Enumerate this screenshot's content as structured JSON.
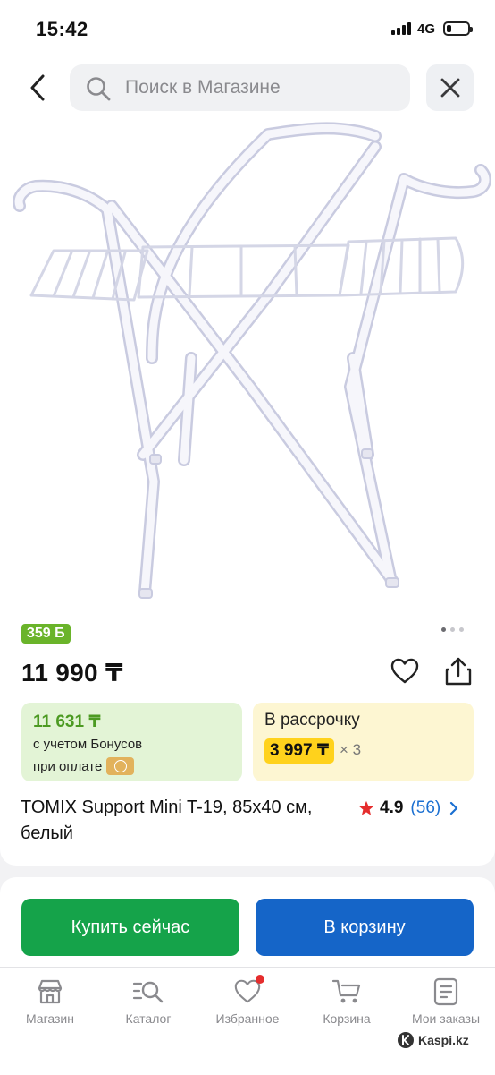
{
  "status_bar": {
    "time": "15:42",
    "network": "4G",
    "battery_level": 0.15
  },
  "header": {
    "search_placeholder": "Поиск в Магазине",
    "back_icon": "chevron-left-icon",
    "close_icon": "close-icon"
  },
  "product": {
    "image_alt": "folding bath stand",
    "image_index": 1,
    "image_count": 3,
    "bonus_badge": "359 Б",
    "price": "11 990 ₸",
    "bonus_price": "11 631 ₸",
    "bonus_line1": "с учетом Бонусов",
    "bonus_line2": "при оплате",
    "installment_label": "В рассрочку",
    "installment_price": "3 997 ₸",
    "installment_multiplier": "× 3",
    "title": "TOMIX Support Mini T-19, 85x40 см, белый",
    "rating": "4.9",
    "reviews": "(56)"
  },
  "actions": {
    "buy_now": "Купить сейчас",
    "add_to_cart": "В корзину"
  },
  "tabs": [
    {
      "label": "Магазин",
      "icon": "store-icon"
    },
    {
      "label": "Каталог",
      "icon": "catalog-search-icon"
    },
    {
      "label": "Избранное",
      "icon": "heart-icon",
      "has_badge": true
    },
    {
      "label": "Корзина",
      "icon": "cart-icon"
    },
    {
      "label": "Мои заказы",
      "icon": "orders-icon"
    }
  ],
  "watermark": "Kaspi.kz",
  "colors": {
    "green": "#15a34a",
    "blue": "#1565c8",
    "yellow": "#ffd21c",
    "badge_green": "#6ab42a",
    "badge_red": "#e52d2d"
  }
}
